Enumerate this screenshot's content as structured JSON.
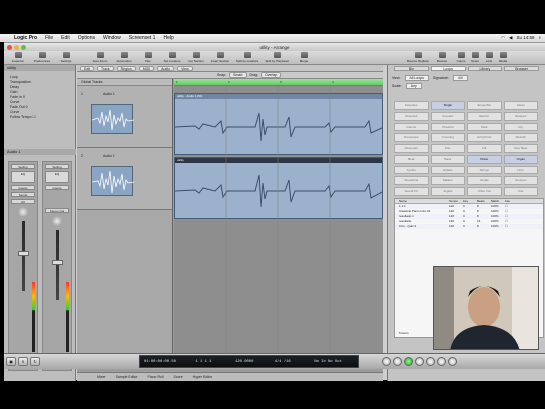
{
  "menubar": {
    "app": "Logic Pro",
    "items": [
      "File",
      "Edit",
      "Options",
      "Window",
      "Screenset 1",
      "Help"
    ],
    "clock": "Su 14:58"
  },
  "window": {
    "title": "utility - Arrange"
  },
  "toolbar": {
    "buttons": [
      "Inspector",
      "Preferences",
      "Settings",
      "Auto Zoom",
      "Automation",
      "Flex",
      "Set Locators",
      "Cut Section",
      "Insert Section",
      "Split by Locators",
      "Split by Playhead",
      "Merge"
    ],
    "right_buttons": [
      "Bounce Replace",
      "Bounce",
      "Colors",
      "Notes",
      "Lists",
      "Media"
    ]
  },
  "inspector": {
    "region_header": "utility",
    "params": [
      {
        "label": "Loop",
        "value": ""
      },
      {
        "label": "Transposition",
        "value": ""
      },
      {
        "label": "Delay",
        "value": ""
      },
      {
        "label": "Gain",
        "value": ""
      },
      {
        "label": "Fade In",
        "value": "0"
      },
      {
        "label": "Curve",
        "value": ""
      },
      {
        "label": "Fade Out",
        "value": "0"
      },
      {
        "label": "Curve",
        "value": ""
      },
      {
        "label": "Follow Tempo",
        "value": ""
      }
    ],
    "track_header": "Audio 1",
    "strip_left": {
      "name": "Audio 1",
      "pan": "0.0",
      "slots": [
        "Setting",
        "EQ",
        "Inserts",
        "Sends",
        "I/O"
      ]
    },
    "strip_right": {
      "name": "Output",
      "pan": "0.0",
      "slots": [
        "Setting",
        "EQ",
        "Inserts",
        "Stereo Out"
      ]
    }
  },
  "arrange": {
    "localbar": [
      "Edit",
      "Track",
      "Region",
      "MIDI",
      "Audio",
      "View"
    ],
    "snap_label": "Snap:",
    "snap_value": "Smart",
    "drag_label": "Drag:",
    "drag_value": "Overlap",
    "global_tracks": "Global Tracks",
    "tracks": [
      {
        "num": "1",
        "name": "Audio 1"
      },
      {
        "num": "2",
        "name": "Audio 1"
      }
    ],
    "ruler_marks": [
      "1",
      "2",
      "3",
      "4"
    ],
    "regions": [
      {
        "name": "utility - Audio 1 #01"
      },
      {
        "name": "utility"
      }
    ],
    "bottom_buttons": [
      "Mixer",
      "Sample Editor",
      "Piano Roll",
      "Score",
      "Hyper Editor"
    ]
  },
  "browser": {
    "tabs": [
      "Bin",
      "Loops",
      "Library",
      "Browser"
    ],
    "view_label": "View:",
    "view_value": "All Loops",
    "signature_label": "Signature:",
    "signature_value": "4/4",
    "scale_label": "Scale:",
    "scale_value": "Any",
    "reset": "Reset",
    "keywords": [
      "Favorites",
      "Single",
      "Ensemble",
      "Clean",
      "Distorted",
      "Acoustic",
      "Electric",
      "Relaxed",
      "Intense",
      "Cheerful",
      "Dark",
      "Dry",
      "Processed",
      "Grooving",
      "Arrhythmic",
      "Melodic",
      "Dissonant",
      "Part",
      "Fill",
      "Elec Beat",
      "Beat",
      "Bass",
      "Piano",
      "Organ",
      "Synths",
      "Guitars",
      "Strings",
      "Horn",
      "Woodwind",
      "Mallets",
      "Vocals",
      "Textures",
      "Sound FX",
      "Jingles",
      "Other Inst",
      "Kits"
    ],
    "active_keywords": [
      "Single",
      "Piano",
      "Organ"
    ],
    "list_columns": [
      "Name",
      "Tempo",
      "Key",
      "Beats",
      "Match",
      "Fav"
    ],
    "list_rows": [
      {
        "name": "1:1:1",
        "tempo": "120",
        "key": "C",
        "beats": "8",
        "match": "100%"
      },
      {
        "name": "Classical Piano Intro 01",
        "tempo": "120",
        "key": "C",
        "beats": "8",
        "match": "100%"
      },
      {
        "name": "resultado 1",
        "tempo": "120",
        "key": "C",
        "beats": "8",
        "match": "100%"
      },
      {
        "name": "resultado",
        "tempo": "120",
        "key": "C",
        "beats": "16",
        "match": "100%"
      },
      {
        "name": "intro - Quiz 2",
        "tempo": "120",
        "key": "C",
        "beats": "8",
        "match": "100%"
      }
    ],
    "footer": "5 items"
  },
  "transport": {
    "time": "01:00:00:00.50",
    "bars": "1 1 1 1",
    "tempo": "120.0000",
    "signature": "4/4",
    "division": "/16",
    "in": "No In",
    "out": "No Out"
  }
}
